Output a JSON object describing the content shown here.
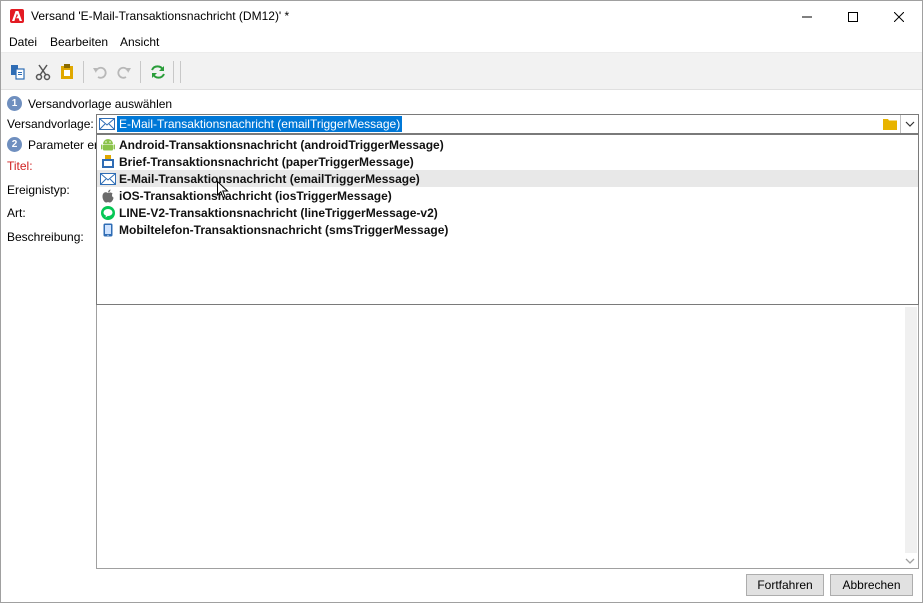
{
  "window": {
    "title": "Versand 'E-Mail-Transaktionsnachricht (DM12)' *",
    "controls": [
      "minimize",
      "maximize",
      "close"
    ]
  },
  "menu": {
    "items": [
      "Datei",
      "Bearbeiten",
      "Ansicht"
    ]
  },
  "toolbar": {
    "icons": [
      "copy-icon",
      "cut-icon",
      "paste-icon",
      "undo-icon",
      "redo-icon",
      "refresh-icon"
    ]
  },
  "steps": [
    {
      "number": "1",
      "label": "Versandvorlage auswählen"
    },
    {
      "number": "2",
      "label": "Parameter er"
    }
  ],
  "form": {
    "template_label": "Versandvorlage:",
    "template_value": "E-Mail-Transaktionsnachricht (emailTriggerMessage)",
    "title_label": "Titel:",
    "event_type_label": "Ereignistyp:",
    "type_label": "Art:",
    "description_label": "Beschreibung:"
  },
  "dropdown": {
    "options": [
      {
        "label": "Android-Transaktionsnachricht (androidTriggerMessage)",
        "icon": "android-icon"
      },
      {
        "label": "Brief-Transaktionsnachricht (paperTriggerMessage)",
        "icon": "letter-icon"
      },
      {
        "label": "E-Mail-Transaktionsnachricht (emailTriggerMessage)",
        "icon": "mail-icon",
        "hover": true
      },
      {
        "label": "iOS-Transaktionsnachricht (iosTriggerMessage)",
        "icon": "apple-icon"
      },
      {
        "label": "LINE-V2-Transaktionsnachricht (lineTriggerMessage-v2)",
        "icon": "line-icon"
      },
      {
        "label": "Mobiltelefon-Transaktionsnachricht (smsTriggerMessage)",
        "icon": "mobile-icon"
      }
    ]
  },
  "buttons": {
    "next": "Fortfahren",
    "cancel": "Abbrechen"
  },
  "colors": {
    "selection": "#0078d7",
    "step_badge": "#6f8fbf",
    "required_label": "#d02020",
    "brand": "#e31b23"
  }
}
